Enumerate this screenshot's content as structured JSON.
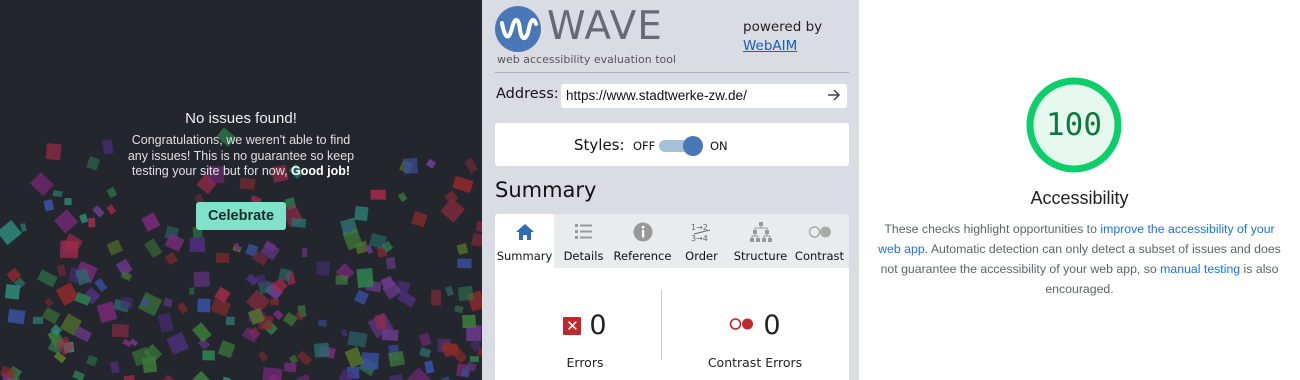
{
  "left": {
    "title": "No issues found!",
    "body_text": "Congratulations, we weren't able to find any issues! This is no guarantee so keep testing your site but for now, ",
    "body_bold": "Good job!",
    "celebrate_label": "Celebrate",
    "background_color": "#23262d",
    "button_color": "#7fe3c8"
  },
  "wave": {
    "logo_word": "WAVE",
    "tagline": "web accessibility evaluation tool",
    "powered_by": "powered by",
    "webaim_link": "WebAIM",
    "address_label": "Address:",
    "address_value": "https://www.stadtwerke-zw.de/",
    "go_icon": "arrow-right-icon",
    "styles_label": "Styles:",
    "styles_off": "OFF",
    "styles_on": "ON",
    "styles_state": "on",
    "summary_title": "Summary",
    "tabs": [
      {
        "label": "Summary",
        "icon": "home-icon",
        "active": true
      },
      {
        "label": "Details",
        "icon": "list-icon",
        "active": false
      },
      {
        "label": "Reference",
        "icon": "info-icon",
        "active": false
      },
      {
        "label": "Order",
        "icon": "order-icon",
        "active": false
      },
      {
        "label": "Structure",
        "icon": "structure-icon",
        "active": false
      },
      {
        "label": "Contrast",
        "icon": "contrast-icon",
        "active": false
      }
    ],
    "errors_count": "0",
    "errors_label": "Errors",
    "contrast_count": "0",
    "contrast_label": "Contrast Errors",
    "accent_color": "#4a77b7",
    "error_color": "#c0282e"
  },
  "lighthouse": {
    "score": "100",
    "title": "Accessibility",
    "desc_part1": "These checks highlight opportunities to ",
    "desc_link1": "improve the accessibility of your web app",
    "desc_part2": ". Automatic detection can only detect a subset of issues and does not guarantee the accessibility of your web app, so ",
    "desc_link2": "manual testing",
    "desc_part3": " is also encouraged.",
    "gauge_color": "#0cce6b",
    "score_color": "#0c7a3b"
  }
}
